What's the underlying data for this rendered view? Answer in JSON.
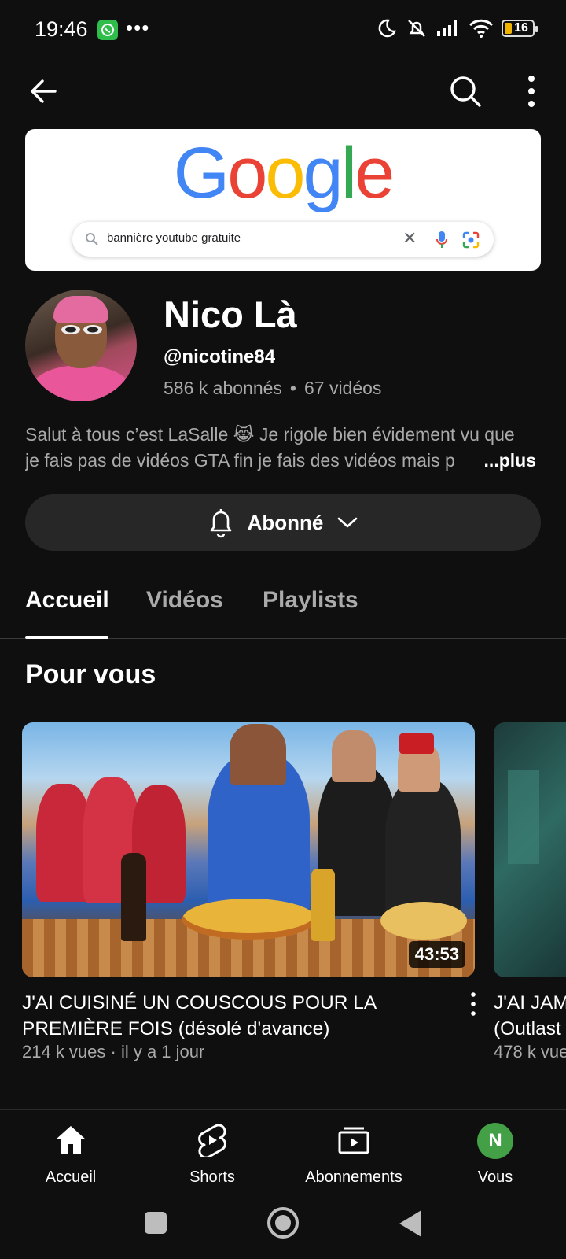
{
  "status_bar": {
    "time": "19:46",
    "battery": "16",
    "icons": [
      "whatsapp-icon",
      "more-dots-icon",
      "do-not-disturb-moon-icon",
      "bell-muted-icon",
      "signal-icon",
      "wifi-icon",
      "battery-icon"
    ]
  },
  "app_bar": {
    "icons": [
      "back-arrow-icon",
      "search-icon",
      "more-vertical-icon"
    ]
  },
  "banner": {
    "logo_letters": [
      "G",
      "o",
      "o",
      "g",
      "l",
      "e"
    ],
    "search_query": "bannière youtube gratuite",
    "clear_glyph": "✕"
  },
  "channel": {
    "name": "Nico Là",
    "handle": "@nicotine84",
    "subscribers": "586 k abonnés",
    "separator": "•",
    "videos_count": "67 vidéos",
    "description_line1": "Salut à tous c’est LaSalle 😹 Je rigole bien évidement vu que",
    "description_line2": "je fais pas de vidéos GTA fin je fais des vidéos mais p",
    "more_label": "...plus",
    "subscribe_label": "Abonné"
  },
  "tabs": [
    {
      "label": "Accueil",
      "active": true
    },
    {
      "label": "Vidéos",
      "active": false
    },
    {
      "label": "Playlists",
      "active": false
    }
  ],
  "section": {
    "title": "Pour vous"
  },
  "videos": [
    {
      "title": "J'AI CUISINÉ UN COUSCOUS POUR LA PREMIÈRE FOIS (désolé d'avance)",
      "meta": "214 k vues · il y a 1 jour",
      "duration": "43:53"
    },
    {
      "title": "J'AI JAM",
      "title_line2": "(Outlast",
      "meta": "478 k vue"
    }
  ],
  "bottom_nav": [
    {
      "label": "Accueil",
      "icon": "home-icon"
    },
    {
      "label": "Shorts",
      "icon": "shorts-icon"
    },
    {
      "label": "Abonnements",
      "icon": "subscriptions-icon"
    },
    {
      "label": "Vous",
      "icon": "avatar",
      "avatar_letter": "N"
    }
  ],
  "colors": {
    "background": "#0f0f0f",
    "secondary_text": "#aaaaaa",
    "button_bg": "#272727",
    "avatar_green": "#43a047"
  }
}
